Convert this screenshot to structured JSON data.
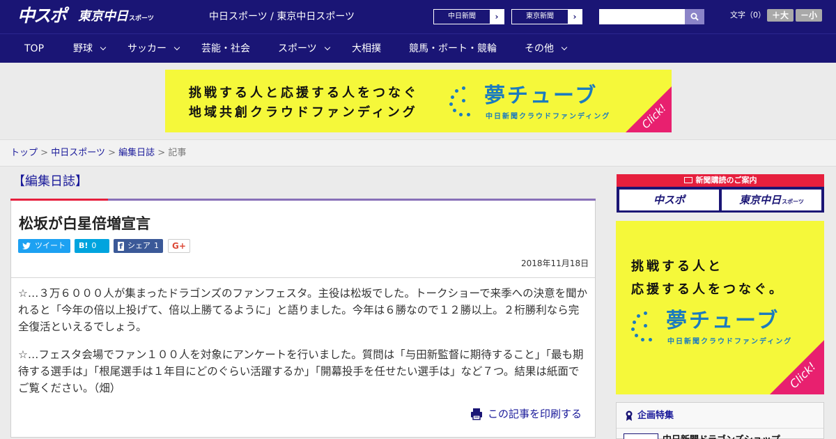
{
  "header": {
    "logo_chuspo": "中スポ",
    "logo_tokyo": "東京中日",
    "logo_tokyo_suffix": "スポーツ",
    "site_links": "中日スポーツ / 東京中日スポーツ",
    "ext_links": [
      {
        "label": "中日新聞",
        "arrow": "›"
      },
      {
        "label": "東京新聞",
        "arrow": "›"
      }
    ],
    "search": {
      "value": "",
      "placeholder": ""
    },
    "font_size_label": "文字（0）",
    "font_bigger": "＋大",
    "font_smaller": "－小"
  },
  "nav": {
    "items": [
      "TOP",
      "野球",
      "サッカー",
      "芸能・社会",
      "スポーツ",
      "大相撲",
      "競馬・ボート・競輪",
      "その他"
    ]
  },
  "banner": {
    "line1": "挑戦する人と応援する人をつなぐ",
    "line2": "地域共創クラウドファンディング",
    "brand": "夢チューブ",
    "brand_sub": "中日新聞クラウドファンディング",
    "click": "Click!"
  },
  "breadcrumb": {
    "items": [
      "トップ",
      "中日スポーツ",
      "編集日誌"
    ],
    "separator": ">",
    "current": "記事"
  },
  "article": {
    "section": "【編集日誌】",
    "title": "松坂が白星倍増宣言",
    "share": {
      "tweet": "ツイート",
      "hatena_icon": "B!",
      "hatena_count": "0",
      "fb_icon": "f",
      "fb_label": "シェア",
      "fb_count": "1",
      "gplus": "G+"
    },
    "date": "2018年11月18日",
    "paragraphs": [
      "☆…３万６０００人が集まったドラゴンズのファンフェスタ。主役は松坂でした。トークショーで来季への決意を聞かれると「今年の倍以上投げて、倍以上勝てるように」と語りました。今年は６勝なので１２勝以上。２桁勝利なら完全復活といえるでしょう。",
      "☆…フェスタ会場でファン１００人を対象にアンケートを行いました。質問は「与田新監督に期待すること」「最も期待する選手は」「根尾選手は１年目にどのぐらい活躍するか」「開幕投手を任せたい選手は」など７つ。結果は紙面でご覧ください。（畑）"
    ],
    "print": "この記事を印刷する"
  },
  "sidebar": {
    "subscribe_head": "新聞購読のご案内",
    "subscribe_logos": [
      "中スポ",
      "東京中日"
    ],
    "subscribe_logo2_suffix": "スポーツ",
    "ad": {
      "line1": "挑戦する人と",
      "line2": "応援する人をつなぐ。",
      "brand": "夢チューブ",
      "brand_sub": "中日新聞クラウドファンディング",
      "click": "Click!"
    },
    "kikaku_title": "企画特集",
    "kikaku_item": "中日新聞ドラゴンズショップ"
  }
}
